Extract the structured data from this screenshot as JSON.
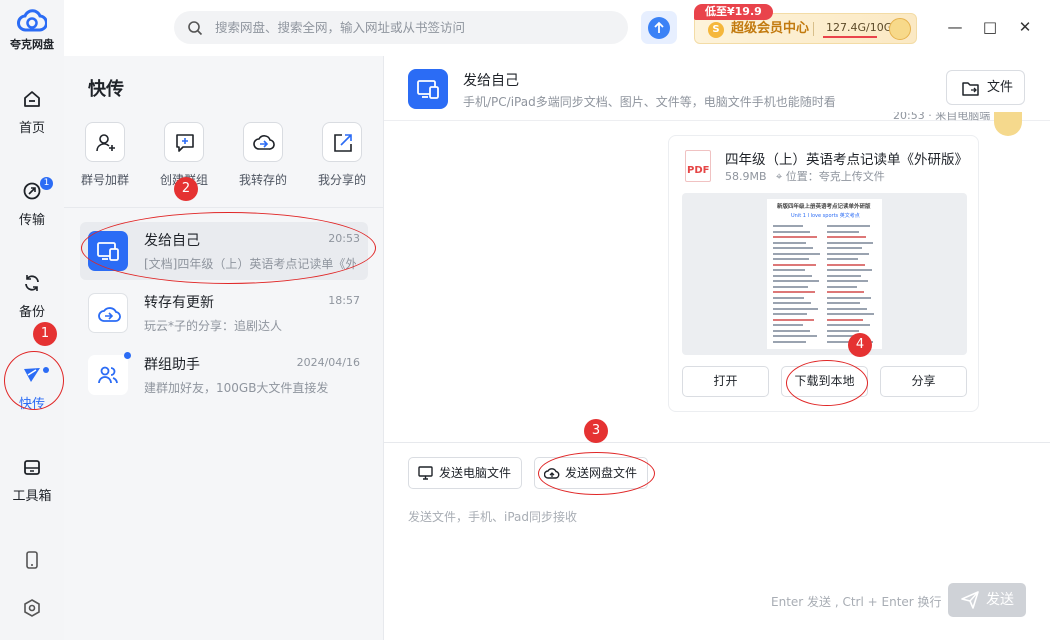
{
  "app": {
    "logo_text": "夸克网盘"
  },
  "nav": [
    {
      "key": "home",
      "label": "首页"
    },
    {
      "key": "transfer",
      "label": "传输",
      "badge": "1"
    },
    {
      "key": "backup",
      "label": "备份"
    },
    {
      "key": "quick_send",
      "label": "快传",
      "active": true,
      "dot": true
    },
    {
      "key": "toolbox",
      "label": "工具箱"
    }
  ],
  "search": {
    "placeholder": "搜索网盘、搜索全网，输入网址或从书签访问"
  },
  "vip": {
    "promo_tag": "低至¥19.9",
    "coin": "S",
    "label": "超级会员中心",
    "storage": "127.4G/10G",
    "usage_fraction": 1.0
  },
  "window": {
    "minimize": "—",
    "maximize": "□",
    "close": "✕"
  },
  "middle": {
    "title": "快传",
    "quick_actions": [
      {
        "key": "join_group",
        "label": "群号加群",
        "icon": "user-plus-icon"
      },
      {
        "key": "create_group",
        "label": "创建群组",
        "icon": "chat-plus-icon"
      },
      {
        "key": "my_saved",
        "label": "我转存的",
        "icon": "cloud-arrow-icon"
      },
      {
        "key": "my_shared",
        "label": "我分享的",
        "icon": "share-out-icon"
      }
    ],
    "messages": [
      {
        "name": "发给自己",
        "time": "20:53",
        "preview": "[文档]四年级（上）英语考点记读单《外研版》(1).pdf",
        "icon": "device-icon",
        "active": true
      },
      {
        "name": "转存有更新",
        "time": "18:57",
        "preview": "玩云*子的分享：追剧达人",
        "icon": "cloud-transfer-icon"
      },
      {
        "name": "群组助手",
        "time": "2024/04/16",
        "preview": "建群加好友，100GB大文件直接发",
        "icon": "group-icon",
        "dot": true
      }
    ]
  },
  "chat": {
    "title": "发给自己",
    "subtitle": "手机/PC/iPad多端同步文档、图片、文件等，电脑文件手机也能随时看",
    "file_button": "文件",
    "sender_meta": "20:53 · 来自电脑端",
    "file_card": {
      "type_label": "PDF",
      "name": "四年级（上）英语考点记读单《外研版》(1).pdf",
      "size": "58.9MB",
      "location": "位置：夸克上传文件",
      "doc_title": "新版四年级上册英语考点记读单外研版",
      "doc_subtitle": "Unit 1 I love sports 英文考点",
      "actions": [
        "打开",
        "下载到本地",
        "分享"
      ]
    },
    "send_computer": "发送电脑文件",
    "send_cloud": "发送网盘文件",
    "input_placeholder": "发送文件，手机、iPad同步接收",
    "enter_hint": "Enter 发送 , Ctrl + Enter 换行",
    "submit": "发送"
  },
  "annotations": [
    "1",
    "2",
    "3",
    "4"
  ]
}
